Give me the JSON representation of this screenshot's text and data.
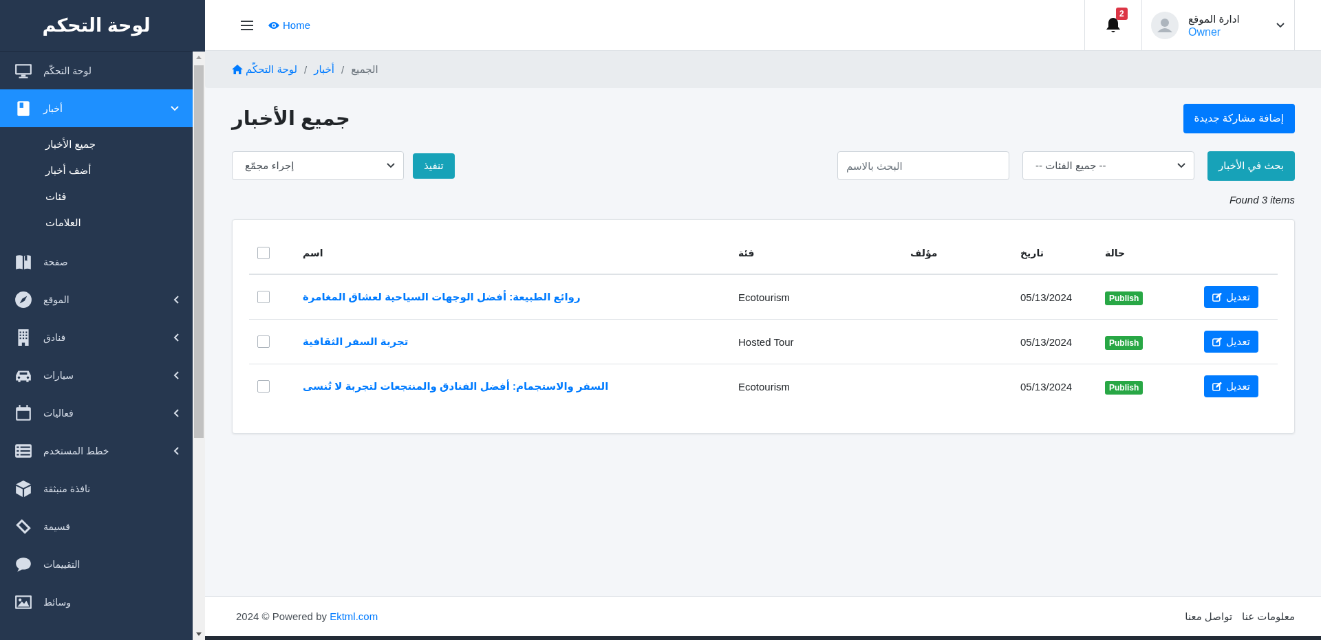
{
  "sidebar": {
    "title": "لوحة التحكم",
    "items": [
      {
        "label": "لوحة التحكّم",
        "kind": "link",
        "selected": false
      },
      {
        "label": "أخبار",
        "kind": "group",
        "selected": true,
        "expanded": true,
        "children": [
          {
            "label": "جميع الأخبار"
          },
          {
            "label": "أضف أخبار"
          },
          {
            "label": "فئات"
          },
          {
            "label": "العلامات"
          }
        ]
      },
      {
        "label": "صفحة",
        "kind": "link",
        "selected": false
      },
      {
        "label": "الموقع",
        "kind": "group",
        "selected": false,
        "expanded": false
      },
      {
        "label": "فنادق",
        "kind": "group",
        "selected": false,
        "expanded": false
      },
      {
        "label": "سيارات",
        "kind": "group",
        "selected": false,
        "expanded": false
      },
      {
        "label": "فعاليات",
        "kind": "group",
        "selected": false,
        "expanded": false
      },
      {
        "label": "خطط المستخدم",
        "kind": "group",
        "selected": false,
        "expanded": false
      },
      {
        "label": "نافذة منبثقة",
        "kind": "link",
        "selected": false
      },
      {
        "label": "قسيمة",
        "kind": "link",
        "selected": false
      },
      {
        "label": "التقييمات",
        "kind": "link",
        "selected": false
      },
      {
        "label": "وسائط",
        "kind": "link",
        "selected": false
      }
    ]
  },
  "topbar": {
    "home": "Home",
    "notifications": "2",
    "user_name": "ادارة الموقع",
    "user_role": "Owner"
  },
  "breadcrumb": {
    "items": [
      {
        "label": "الجميع",
        "current": true
      },
      {
        "label": "أخبار",
        "current": false
      },
      {
        "label": "لوحة التحكّم",
        "current": false
      }
    ],
    "separators": [
      "/",
      "/"
    ]
  },
  "page_title": "جميع الأخبار",
  "add_button": "إضافة مشاركة جديدة",
  "bulk_action": {
    "value": "إجراء مجمّع",
    "button": "تنفيذ"
  },
  "search": {
    "placeholder": "البحث بالاسم",
    "category": "-- جميع الفئات --",
    "button": "بحث في الأخبار"
  },
  "result_count": "Found 3 items",
  "table": {
    "columns": [
      "حالة",
      "تاريخ",
      "مؤلف",
      "فئة",
      "اسم"
    ],
    "header_checked": false,
    "rows": [
      {
        "checked": false,
        "name": "روائع الطبيعة: أفضل الوجهات السياحية لعشاق المغامرة",
        "category": "Ecotourism",
        "date": "05/13/2024",
        "status": "Publish",
        "action": "تعديل"
      },
      {
        "checked": false,
        "name": "تجربة السفر الثقافية",
        "category": "Hosted Tour",
        "date": "05/13/2024",
        "status": "Publish",
        "action": "تعديل"
      },
      {
        "checked": false,
        "name": "السفر والاستجمام: أفضل الفنادق والمنتجعات لتجربة لا تُنسى",
        "category": "Ecotourism",
        "date": "05/13/2024",
        "status": "Publish",
        "action": "تعديل"
      }
    ]
  },
  "footer": {
    "copyright": "2024 © Powered by",
    "link": "Ektml.com",
    "links": [
      "معلومات عنا",
      "تواصل معنا"
    ]
  }
}
